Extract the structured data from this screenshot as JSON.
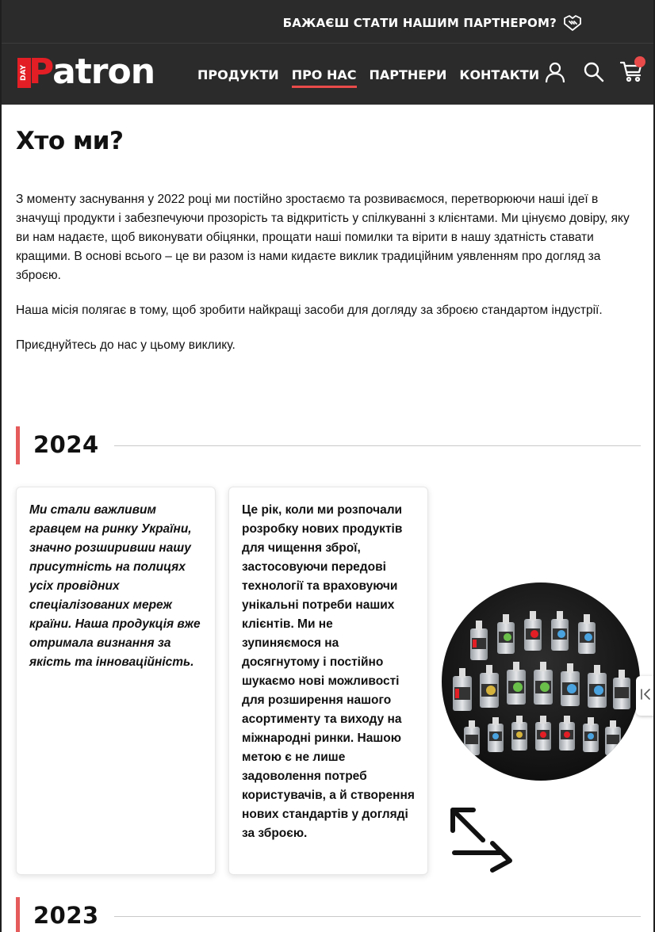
{
  "topbar": {
    "partner_text": "БАЖАЄШ СТАТИ НАШИМ ПАРТНЕРОМ?",
    "partner_icon": "handshake-icon"
  },
  "nav": {
    "logo_day": "DAY",
    "logo_letter": "P",
    "logo_rest": "atron",
    "items": [
      {
        "label": "ПРОДУКТИ",
        "active": false
      },
      {
        "label": "ПРО НАС",
        "active": true
      },
      {
        "label": "ПАРТНЕРИ",
        "active": false
      },
      {
        "label": "КОНТАКТИ",
        "active": false
      }
    ],
    "icons": [
      "user-icon",
      "search-icon",
      "cart-icon"
    ]
  },
  "about": {
    "title": "Хто ми?",
    "p1": "З моменту заснування у 2022 році ми постійно зростаємо та розвиваємося, перетворюючи наші ідеї в значущі продукти і забезпечуючи прозорість та відкритість у спілкуванні з клієнтами. Ми цінуємо довіру, яку ви нам надаєте, щоб виконувати обіцянки, прощати наші помилки та вірити в нашу здатність ставати кращими. В основі всього – це ви разом із нами кидаєте виклик традиційним уявленням про догляд за зброєю.",
    "p2": "Наша місія полягає в тому, щоб зробити найкращі засоби для догляду за зброєю стандартом індустрії.",
    "p3": "Приєднуйтесь до нас у цьому виклику."
  },
  "timeline": [
    {
      "year": "2024",
      "card1": "Ми стали важливим гравцем на ринку України, значно розширивши нашу присутність на полицях усіх провідних спеціалізованих мереж країни. Наша продукція вже отримала визнання за якість та інноваційність.",
      "card2": "Це рік, коли ми розпочали розробку нових продуктів для чищення зброї, застосовуючи передові технології та враховуючи унікальні потреби наших клієнтів. Ми не зупиняємося на досягнутому і постійно шукаємо нові можливості для розширення нашого асортименту та виходу на міжнародні ринки. Нашою метою є не лише задоволення потреб користувачів, а й створення нових стандартів у догляді за зброєю."
    },
    {
      "year": "2023"
    }
  ],
  "colors": {
    "header_bg": "#2b2b2b",
    "accent": "#e31e24",
    "year_bar": "#e55a5a"
  }
}
